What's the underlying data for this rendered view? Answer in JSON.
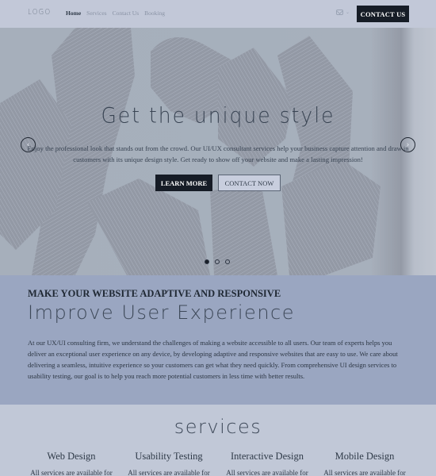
{
  "header": {
    "logo": "LOGO",
    "nav": [
      {
        "label": "Home",
        "active": true
      },
      {
        "label": "Services",
        "active": false
      },
      {
        "label": "Contact Us",
        "active": false
      },
      {
        "label": "Booking",
        "active": false
      }
    ],
    "mail_icon": "mail-icon",
    "dropdown_caret": "⌄",
    "contact_button": "CONTACT US"
  },
  "hero": {
    "title": "Get the unique style",
    "text": "Enjoy the professional look that stands out from the crowd. Our UI/UX consultant services help your business capture attention and draw in customers with its unique design style. Get ready to show off your website and make a lasting impression!",
    "learn_more": "LEARN MORE",
    "contact_now": "CONTACT NOW",
    "prev_arrow": "‹",
    "next_arrow": "›",
    "slides": 3,
    "active_slide": 1
  },
  "improve": {
    "kicker": "MAKE YOUR WEBSITE ADAPTIVE AND RESPONSIVE",
    "title": "Improve User Experience",
    "body": "At our UX/UI consulting firm, we understand the challenges of making a website accessible to all users. Our team of experts helps you deliver an exceptional user experience on any device, by developing adaptive and responsive websites that are easy to use. We care about delivering a seamless, intuitive experience so your customers can get what they need quickly. From comprehensive UI design services to usability testing, our goal is to help you reach more potential customers in less time with better results."
  },
  "services": {
    "title": "services",
    "items": [
      {
        "name": "Web Design",
        "desc": "All services are available for"
      },
      {
        "name": "Usability Testing",
        "desc": "All services are available for"
      },
      {
        "name": "Interactive Design",
        "desc": "All services are available for"
      },
      {
        "name": "Mobile Design",
        "desc": "All services are available for"
      }
    ]
  }
}
